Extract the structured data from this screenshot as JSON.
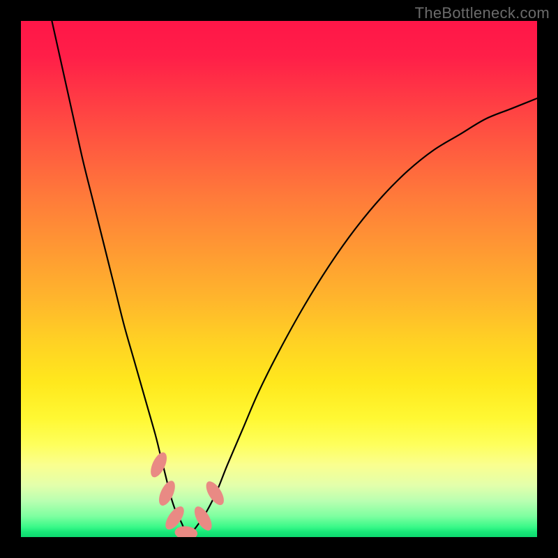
{
  "watermark": "TheBottleneck.com",
  "colors": {
    "frame_bg": "#000000",
    "watermark": "#6b6b6b",
    "curve": "#000000",
    "nodule": "#e98a84"
  },
  "chart_data": {
    "type": "line",
    "title": "",
    "xlabel": "",
    "ylabel": "",
    "xlim": [
      0,
      100
    ],
    "ylim": [
      0,
      100
    ],
    "grid": false,
    "legend": false,
    "series": [
      {
        "name": "curve",
        "x": [
          6,
          8,
          10,
          12,
          14,
          16,
          18,
          20,
          22,
          24,
          26,
          27,
          28,
          29,
          30,
          31,
          32,
          33,
          34,
          36,
          38,
          40,
          43,
          46,
          50,
          55,
          60,
          65,
          70,
          75,
          80,
          85,
          90,
          95,
          100
        ],
        "values": [
          100,
          91,
          82,
          73,
          65,
          57,
          49,
          41,
          34,
          27,
          20,
          16,
          12,
          8,
          5,
          3,
          1,
          1,
          2,
          5,
          9,
          14,
          21,
          28,
          36,
          45,
          53,
          60,
          66,
          71,
          75,
          78,
          81,
          83,
          85
        ]
      }
    ],
    "nodules": [
      {
        "x": 26.7,
        "y": 14.0,
        "rx": 1.2,
        "ry": 2.6,
        "rot": 25
      },
      {
        "x": 28.3,
        "y": 8.5,
        "rx": 1.2,
        "ry": 2.6,
        "rot": 25
      },
      {
        "x": 29.8,
        "y": 3.7,
        "rx": 1.2,
        "ry": 2.6,
        "rot": 35
      },
      {
        "x": 32.0,
        "y": 0.8,
        "rx": 2.2,
        "ry": 1.3,
        "rot": 5
      },
      {
        "x": 35.3,
        "y": 3.6,
        "rx": 1.2,
        "ry": 2.6,
        "rot": -30
      },
      {
        "x": 37.6,
        "y": 8.5,
        "rx": 1.2,
        "ry": 2.6,
        "rot": -32
      }
    ]
  }
}
